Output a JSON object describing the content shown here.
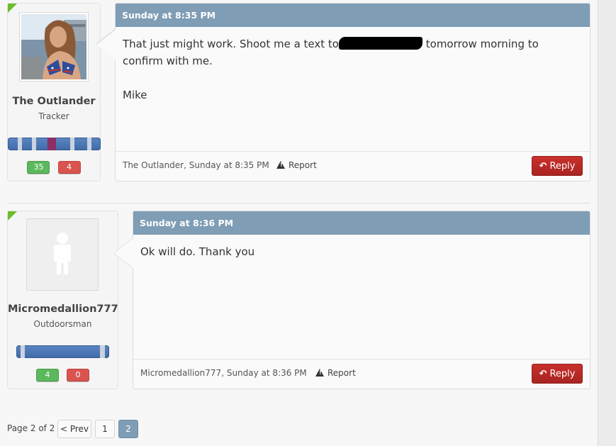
{
  "posts": [
    {
      "author": "The Outlander",
      "user_title": "Tracker",
      "avatar": "user-photo",
      "positive": "35",
      "negative": "4",
      "date": "Sunday at 8:35 PM",
      "body": {
        "line1_before": "That just might work. Shoot me a text to",
        "line1_after": "tomorrow morning to",
        "line2": "confirm with me.",
        "signature": "Mike"
      },
      "footer_meta": "The Outlander, Sunday at 8:35 PM",
      "report_label": "Report",
      "reply_label": "Reply"
    },
    {
      "author": "Micromedallion777",
      "user_title": "Outdoorsman",
      "avatar": "default-user-icon",
      "positive": "4",
      "negative": "0",
      "date": "Sunday at 8:36 PM",
      "body": {
        "line1": "Ok will do. Thank you"
      },
      "footer_meta": "Micromedallion777, Sunday at 8:36 PM",
      "report_label": "Report",
      "reply_label": "Reply"
    }
  ],
  "pagination": {
    "label": "Page 2 of 2",
    "prev_label": "< Prev",
    "pages": [
      "1",
      "2"
    ],
    "current": "2"
  },
  "colors": {
    "header": "#7f9db5",
    "reply": "#c9302c",
    "positive": "#5cb85c",
    "negative": "#d9534f",
    "corner": "#6cbd2a"
  }
}
